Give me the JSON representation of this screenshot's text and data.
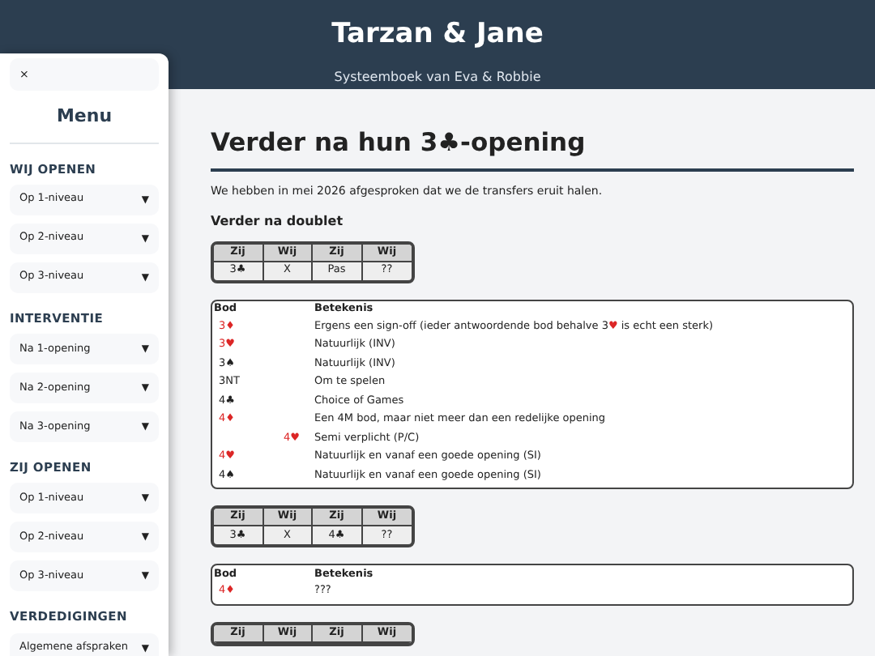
{
  "header": {
    "title": "Tarzan & Jane",
    "subtitle": "Systeemboek van Eva & Robbie"
  },
  "sidebar": {
    "close": "×",
    "title": "Menu",
    "sections": [
      {
        "heading": "WIJ OPENEN",
        "items": [
          {
            "label": "Op 1-niveau",
            "caret": "▼"
          },
          {
            "label": "Op 2-niveau",
            "caret": "▼"
          },
          {
            "label": "Op 3-niveau",
            "caret": "▼"
          }
        ]
      },
      {
        "heading": "INTERVENTIE",
        "items": [
          {
            "label": "Na 1-opening",
            "caret": "▼"
          },
          {
            "label": "Na 2-opening",
            "caret": "▼"
          },
          {
            "label": "Na 3-opening",
            "caret": "▼"
          }
        ]
      },
      {
        "heading": "ZIJ OPENEN",
        "items": [
          {
            "label": "Op 1-niveau",
            "caret": "▼"
          },
          {
            "label": "Op 2-niveau",
            "caret": "▼"
          },
          {
            "label": "Op 3-niveau",
            "caret": "▼"
          }
        ]
      },
      {
        "heading": "VERDEDIGINGEN",
        "items": [
          {
            "label": "Algemene afspraken",
            "caret": "▼"
          }
        ]
      }
    ]
  },
  "main": {
    "title": "Verder na hun 3♣-opening",
    "intro": "We hebben in mei 2026 afgesproken dat we de transfers eruit halen.",
    "subtitle": "Verder na doublet",
    "blocks": [
      {
        "kind": "auction",
        "columns": [
          "Zij",
          "Wij",
          "Zij",
          "Wij"
        ],
        "rows": [
          [
            "3♣",
            "X",
            "Pas",
            "??"
          ]
        ]
      },
      {
        "kind": "meanings",
        "columns": [
          "Bod",
          "Betekenis"
        ],
        "rows": [
          {
            "bid": "3♦",
            "color": "#dc2626",
            "meaning": [
              {
                "text": "Ergens een sign-off (ieder antwoordende bod behalve 3"
              },
              {
                "text": "♥",
                "color": "#dc2626"
              },
              {
                "text": " is echt een sterk)"
              }
            ]
          },
          {
            "bid": "3♥",
            "color": "#dc2626",
            "meaning": [
              {
                "text": "Natuurlijk (INV)"
              }
            ]
          },
          {
            "bid": "3♠",
            "color": "#222222",
            "meaning": [
              {
                "text": "Natuurlijk (INV)"
              }
            ]
          },
          {
            "bid": "3NT",
            "color": "#222222",
            "meaning": [
              {
                "text": "Om te spelen"
              }
            ]
          },
          {
            "bid": "4♣",
            "color": "#222222",
            "meaning": [
              {
                "text": "Choice of Games"
              }
            ]
          },
          {
            "bid": "4♦",
            "color": "#dc2626",
            "meaning": [
              {
                "text": "Een 4M bod, maar niet meer dan een redelijke opening"
              }
            ],
            "children": [
              {
                "bid": "4♥",
                "color": "#dc2626",
                "meaning": [
                  {
                    "text": "Semi verplicht (P/C)"
                  }
                ]
              }
            ]
          },
          {
            "bid": "4♥",
            "color": "#dc2626",
            "meaning": [
              {
                "text": "Natuurlijk en vanaf een goede opening (SI)"
              }
            ]
          },
          {
            "bid": "4♠",
            "color": "#222222",
            "meaning": [
              {
                "text": "Natuurlijk en vanaf een goede opening (SI)"
              }
            ]
          }
        ]
      },
      {
        "kind": "auction",
        "columns": [
          "Zij",
          "Wij",
          "Zij",
          "Wij"
        ],
        "rows": [
          [
            "3♣",
            "X",
            "4♣",
            "??"
          ]
        ]
      },
      {
        "kind": "meanings",
        "columns": [
          "Bod",
          "Betekenis"
        ],
        "rows": [
          {
            "bid": "4♦",
            "color": "#dc2626",
            "meaning": [
              {
                "text": "???"
              }
            ]
          }
        ]
      },
      {
        "kind": "auction",
        "columns": [
          "Zij",
          "Wij",
          "Zij",
          "Wij"
        ]
      }
    ]
  }
}
